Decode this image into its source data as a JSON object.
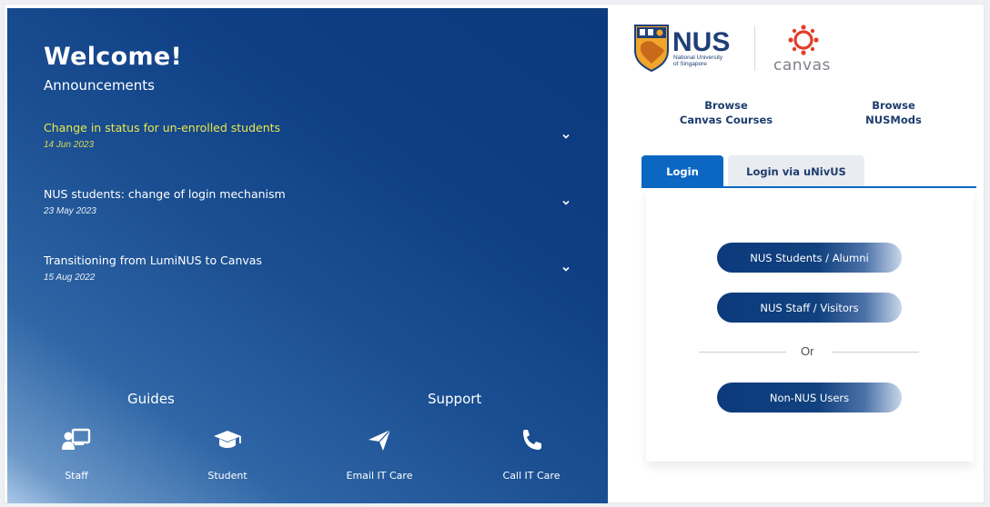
{
  "left": {
    "welcome": "Welcome!",
    "announcements_title": "Announcements",
    "announcements": [
      {
        "title": "Change in status for un-enrolled students",
        "date": "14 Jun 2023"
      },
      {
        "title": "NUS students: change of login mechanism",
        "date": "23 May 2023"
      },
      {
        "title": "Transitioning from LumiNUS to Canvas",
        "date": "15 Aug 2022"
      }
    ],
    "guides_title": "Guides",
    "support_title": "Support",
    "links": [
      {
        "label": "Staff",
        "icon": "staff-board-icon"
      },
      {
        "label": "Student",
        "icon": "graduation-cap-icon"
      },
      {
        "label": "Email IT Care",
        "icon": "paper-plane-icon"
      },
      {
        "label": "Call IT Care",
        "icon": "phone-icon"
      }
    ],
    "highlight_color": "#e8e84a"
  },
  "right": {
    "nus_logo_text": "NUS",
    "nus_logo_sub1": "National University",
    "nus_logo_sub2": "of Singapore",
    "canvas_logo_text": "canvas",
    "browse_courses": [
      "Browse",
      "Canvas Courses"
    ],
    "browse_nusmods": [
      "Browse",
      "NUSMods"
    ],
    "tabs": [
      "Login",
      "Login via uNivUS"
    ],
    "buttons": {
      "students": "NUS Students / Alumni",
      "staff": "NUS Staff / Visitors",
      "or": "Or",
      "non_nus": "Non-NUS Users"
    },
    "accent": "#0b67c2",
    "canvas_red": "#e13f2b"
  }
}
